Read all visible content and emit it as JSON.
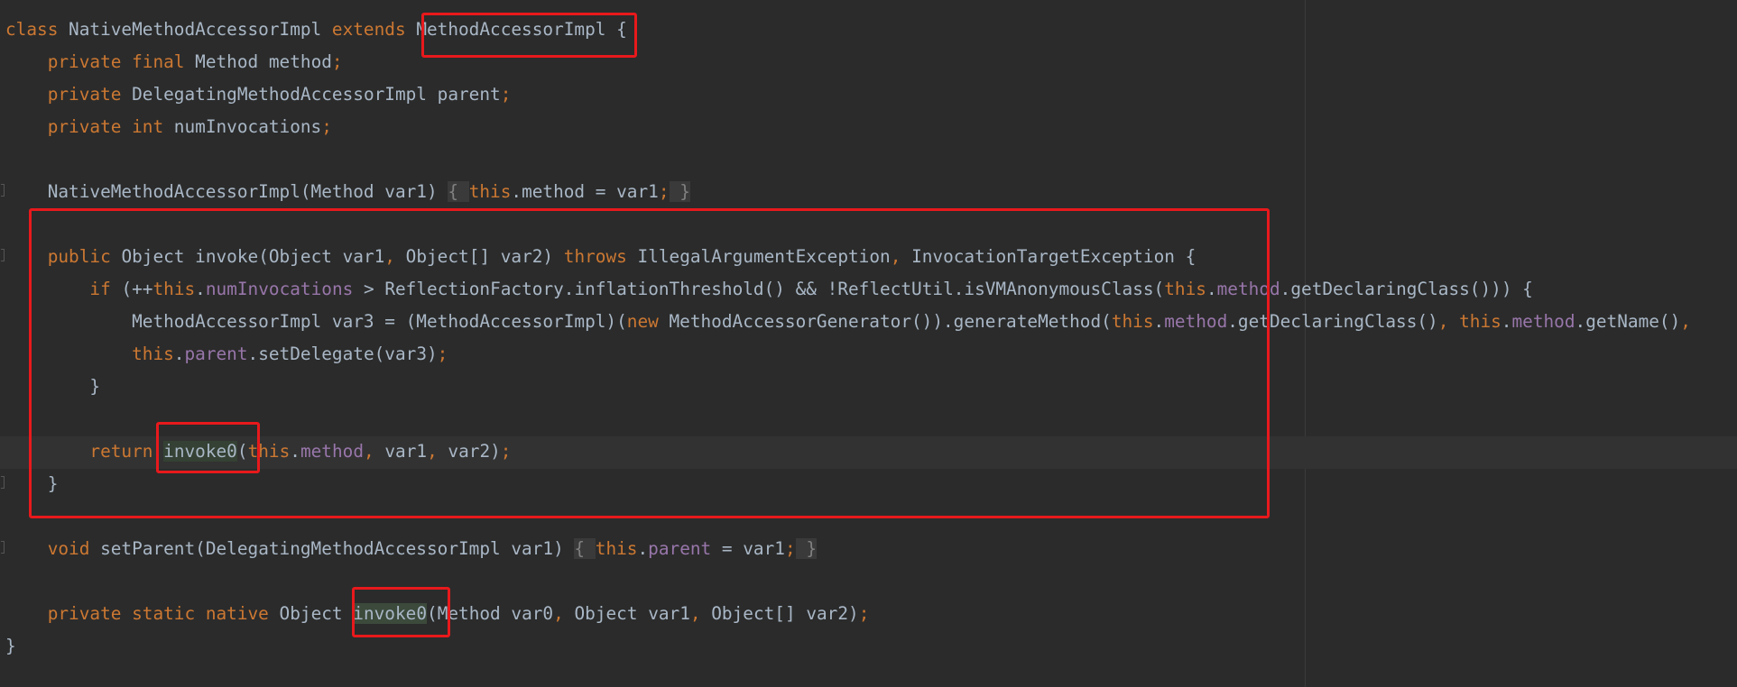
{
  "code": {
    "lines": [
      [
        [
          "kw",
          "class "
        ],
        [
          "pl",
          "NativeMethodAccessorImpl "
        ],
        [
          "kw",
          "extends "
        ],
        [
          "pl",
          "MethodAccessorImpl "
        ],
        [
          "pl",
          "{"
        ]
      ],
      [
        [
          "pl",
          "    "
        ],
        [
          "kw",
          "private final "
        ],
        [
          "pl",
          "Method method"
        ],
        [
          "pu",
          ";"
        ]
      ],
      [
        [
          "pl",
          "    "
        ],
        [
          "kw",
          "private "
        ],
        [
          "pl",
          "DelegatingMethodAccessorImpl parent"
        ],
        [
          "pu",
          ";"
        ]
      ],
      [
        [
          "pl",
          "    "
        ],
        [
          "kw",
          "private int "
        ],
        [
          "pl",
          "numInvocations"
        ],
        [
          "pu",
          ";"
        ]
      ],
      [],
      [
        [
          "pl",
          "    NativeMethodAccessorImpl(Method var1) "
        ],
        [
          "fb",
          "{ "
        ],
        [
          "kw",
          "this"
        ],
        [
          "pl",
          ".method = var1"
        ],
        [
          "pu",
          ";"
        ],
        [
          "fb",
          " }"
        ]
      ],
      [],
      [
        [
          "pl",
          "    "
        ],
        [
          "kw",
          "public "
        ],
        [
          "pl",
          "Object invoke(Object var1"
        ],
        [
          "pu",
          ", "
        ],
        [
          "pl",
          "Object[] var2) "
        ],
        [
          "kw",
          "throws "
        ],
        [
          "pl",
          "IllegalArgumentException"
        ],
        [
          "pu",
          ", "
        ],
        [
          "pl",
          "InvocationTargetException {"
        ]
      ],
      [
        [
          "pl",
          "        "
        ],
        [
          "kw",
          "if "
        ],
        [
          "pl",
          "(++"
        ],
        [
          "kw",
          "this"
        ],
        [
          "pl",
          "."
        ],
        [
          "fd",
          "numInvocations"
        ],
        [
          "pl",
          " > ReflectionFactory.inflationThreshold() && !ReflectUtil.isVMAnonymousClass("
        ],
        [
          "kw",
          "this"
        ],
        [
          "pl",
          "."
        ],
        [
          "fd",
          "method"
        ],
        [
          "pl",
          ".getDeclaringClass())) {"
        ]
      ],
      [
        [
          "pl",
          "            MethodAccessorImpl var3 = (MethodAccessorImpl)("
        ],
        [
          "kw",
          "new "
        ],
        [
          "pl",
          "MethodAccessorGenerator()).generateMethod("
        ],
        [
          "kw",
          "this"
        ],
        [
          "pl",
          "."
        ],
        [
          "fd",
          "method"
        ],
        [
          "pl",
          ".getDeclaringClass()"
        ],
        [
          "pu",
          ", "
        ],
        [
          "kw",
          "this"
        ],
        [
          "pl",
          "."
        ],
        [
          "fd",
          "method"
        ],
        [
          "pl",
          ".getName()"
        ],
        [
          "pu",
          ","
        ]
      ],
      [
        [
          "pl",
          "            "
        ],
        [
          "kw",
          "this"
        ],
        [
          "pl",
          "."
        ],
        [
          "fd",
          "parent"
        ],
        [
          "pl",
          ".setDelegate(var3)"
        ],
        [
          "pu",
          ";"
        ]
      ],
      [
        [
          "pl",
          "        }"
        ]
      ],
      [],
      [
        [
          "pl",
          "        "
        ],
        [
          "kw",
          "return "
        ],
        [
          "hu",
          "invoke0"
        ],
        [
          "pl",
          "("
        ],
        [
          "kw",
          "this"
        ],
        [
          "pl",
          "."
        ],
        [
          "fd",
          "method"
        ],
        [
          "pu",
          ", "
        ],
        [
          "pl",
          "var1"
        ],
        [
          "pu",
          ", "
        ],
        [
          "pl",
          "var2)"
        ],
        [
          "pu",
          ";"
        ]
      ],
      [
        [
          "pl",
          "    }"
        ]
      ],
      [],
      [
        [
          "pl",
          "    "
        ],
        [
          "kw",
          "void "
        ],
        [
          "pl",
          "setParent(DelegatingMethodAccessorImpl var1) "
        ],
        [
          "fb",
          "{ "
        ],
        [
          "kw",
          "this"
        ],
        [
          "pl",
          "."
        ],
        [
          "fd",
          "parent"
        ],
        [
          "pl",
          " = var1"
        ],
        [
          "pu",
          ";"
        ],
        [
          "fb",
          " }"
        ]
      ],
      [],
      [
        [
          "pl",
          "    "
        ],
        [
          "kw",
          "private static native "
        ],
        [
          "pl",
          "Object "
        ],
        [
          "hd",
          "invoke0"
        ],
        [
          "pl",
          "(Method var0"
        ],
        [
          "pu",
          ", "
        ],
        [
          "pl",
          "Object var1"
        ],
        [
          "pu",
          ", "
        ],
        [
          "pl",
          "Object[] var2)"
        ],
        [
          "pu",
          ";"
        ]
      ],
      [
        [
          "pl",
          "}"
        ]
      ]
    ]
  },
  "colors": {
    "background": "#2b2b2b",
    "keyword": "#cc7832",
    "identifier": "#a9b7c6",
    "field": "#9876aa",
    "annotation_box": "#e8191c"
  }
}
